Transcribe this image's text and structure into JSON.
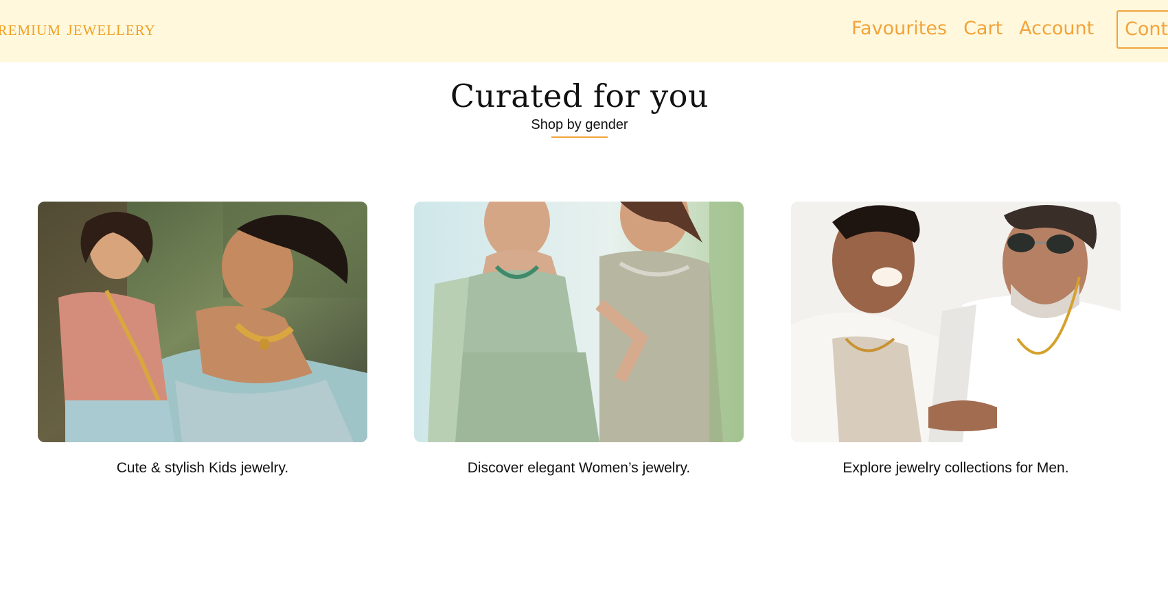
{
  "header": {
    "brand": "Premium Jewellery",
    "nav": [
      {
        "label": "Favourites"
      },
      {
        "label": "Cart"
      },
      {
        "label": "Account"
      }
    ],
    "contact_label": "Cont",
    "colors": {
      "background": "#fff8dd",
      "accent": "#f2a33a"
    }
  },
  "section": {
    "title": "Curated for you",
    "subtitle": "Shop by gender"
  },
  "cards": [
    {
      "caption": "Cute & stylish Kids jewelry."
    },
    {
      "caption": "Discover elegant Women’s jewelry."
    },
    {
      "caption": "Explore jewelry collections for Men."
    }
  ]
}
